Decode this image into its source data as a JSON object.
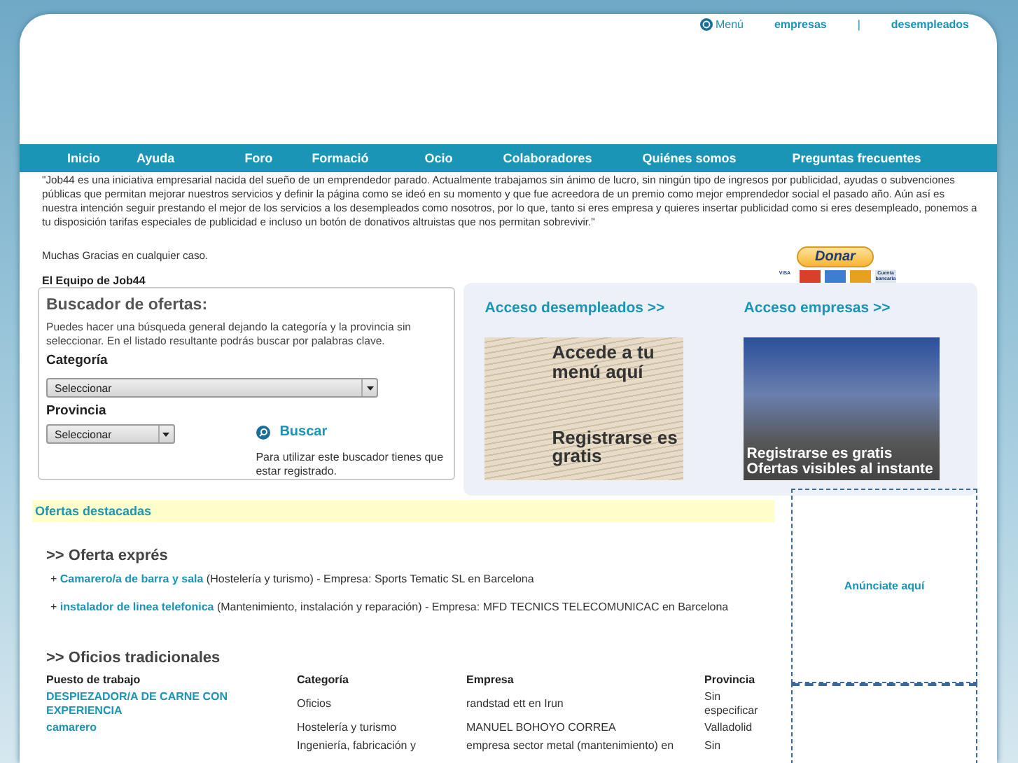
{
  "top_links": {
    "menu": "Menú",
    "links": [
      "empresas",
      "|",
      "desempleados"
    ]
  },
  "nav": [
    "Inicio",
    "Ayuda",
    "Foro",
    "Formació",
    "Ocio",
    "Colaboradores",
    "Quiénes somos",
    "Preguntas frecuentes"
  ],
  "intro": {
    "quote": "\"Job44 es una iniciativa empresarial nacida del sueño de un emprendedor parado. Actualmente trabajamos sin ánimo de lucro, sin ningún tipo de ingresos por publicidad, ayudas o subvenciones públicas que permitan mejorar nuestros servicios y definir la página como se ideó en su momento y que fue acreedora de un premio como mejor emprendedor social el pasado año. Aún así es nuestra intención seguir prestando el mejor de los servicios a los desempleados como nosotros, por lo que, tanto si eres empresa y quieres insertar publicidad como si eres desempleado, ponemos a tu disposición tarifas especiales de publicidad e incluso un botón de donativos altruistas que nos permitan sobrevivir.\"",
    "thanks": "Muchas Gracias en cualquier caso.",
    "signature": "El Equipo de Job44"
  },
  "donate": {
    "label": "Donar",
    "cards": [
      {
        "label": "VISA",
        "color": "#ffffff"
      },
      {
        "color": "#d8402a"
      },
      {
        "color": "#3a7fd0"
      },
      {
        "color": "#e8a020"
      },
      {
        "label": "Cuenta bancaria",
        "color": "#dde4ee"
      }
    ]
  },
  "search": {
    "title": "Buscador de ofertas:",
    "help": "Puedes hacer una búsqueda general dejando la categoría y la provincia sin seleccionar. En el listado resultante podrás buscar por palabras clave.",
    "category_label": "Categoría",
    "category_value": "Seleccionar",
    "province_label": "Provincia",
    "province_value": "Seleccionar",
    "button": "Buscar",
    "note": "Para utilizar este buscador tienes que estar registrado."
  },
  "access": [
    {
      "title": "Acceso desempleados >>",
      "kind": "newspaper",
      "banner_lines": [
        "Accede a tu menú aquí",
        "Registrarse es gratis"
      ]
    },
    {
      "title": "Acceso empresas >>",
      "kind": "building",
      "banner_lines": [
        "Registrarse es gratis",
        "Ofertas visibles al instante"
      ]
    }
  ],
  "featured": {
    "title": "Ofertas destacadas",
    "express_title": ">> Oferta exprés",
    "express": [
      {
        "bullet": "+",
        "job": "Camarero/a de barra y sala",
        "detail": "(Hostelería y turismo) - Empresa: Sports Tematic SL en Barcelona"
      },
      {
        "bullet": "+",
        "job": "instalador de linea telefonica",
        "detail": "(Mantenimiento, instalación y reparación) - Empresa: MFD TECNICS TELECOMUNICAC en Barcelona"
      }
    ],
    "traditional_title": ">> Oficios tradicionales",
    "columns": [
      "Puesto de trabajo",
      "Categoría",
      "Empresa",
      "Provincia"
    ],
    "rows": [
      {
        "job": "DESPIEZADOR/A DE CARNE CON EXPERIENCIA",
        "category": "Oficios",
        "company": "randstad ett en Irun",
        "province": "Sin especificar"
      },
      {
        "job": "camarero",
        "category": "Hostelería y turismo",
        "company": "MANUEL BOHOYO CORREA",
        "province": "Valladolid"
      },
      {
        "category": "Ingeniería, fabricación y",
        "company": "empresa sector metal (mantenimiento) en",
        "province": "Sin"
      }
    ]
  },
  "ad": {
    "label": "Anúnciate aquí"
  }
}
